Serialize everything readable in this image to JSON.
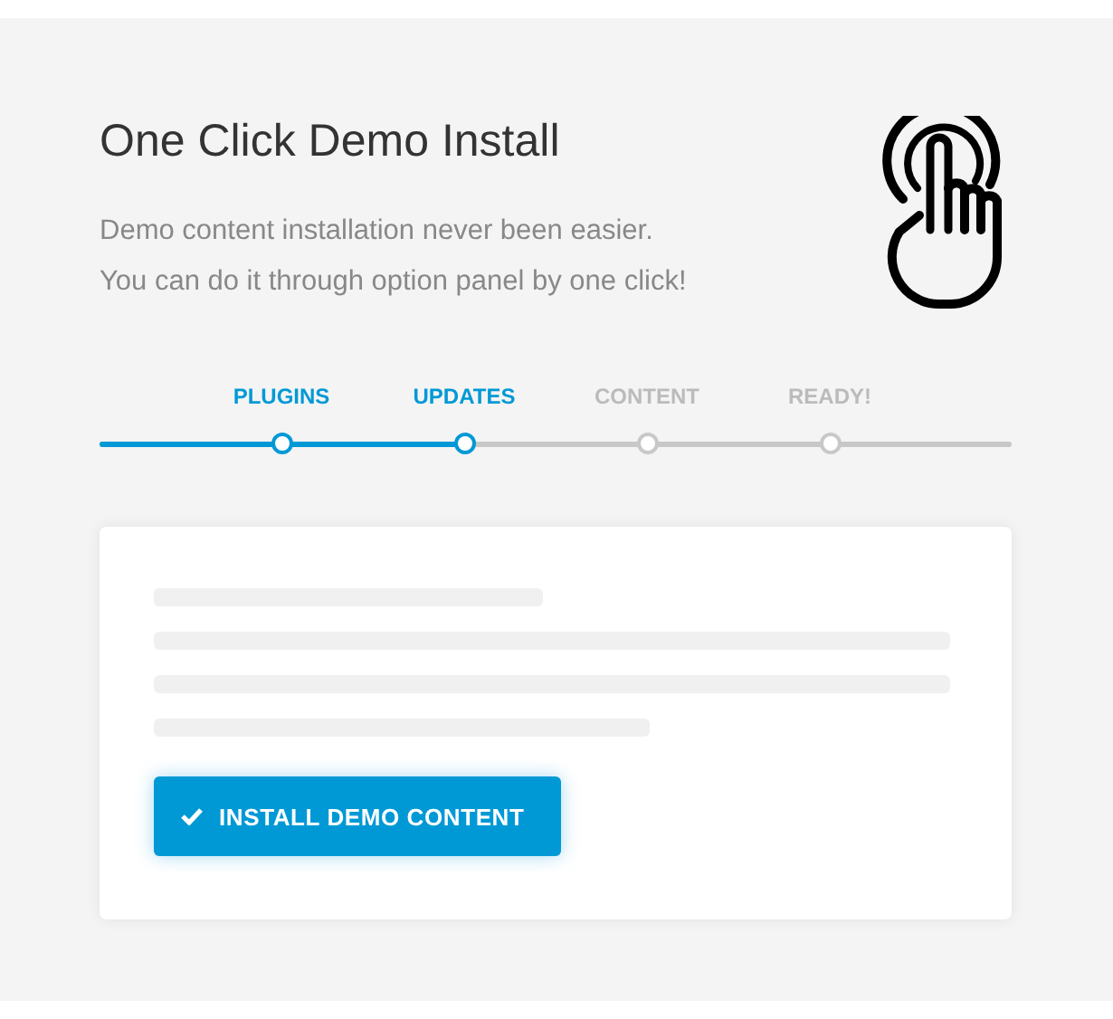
{
  "title": "One Click Demo Install",
  "description": [
    "Demo content installation never been easier.",
    "You can do it through option panel by one click!"
  ],
  "steps": [
    {
      "label": "PLUGINS",
      "completed": true
    },
    {
      "label": "UPDATES",
      "completed": true
    },
    {
      "label": "CONTENT",
      "completed": false
    },
    {
      "label": "READY!",
      "completed": false
    }
  ],
  "button": {
    "label": "INSTALL DEMO CONTENT"
  }
}
